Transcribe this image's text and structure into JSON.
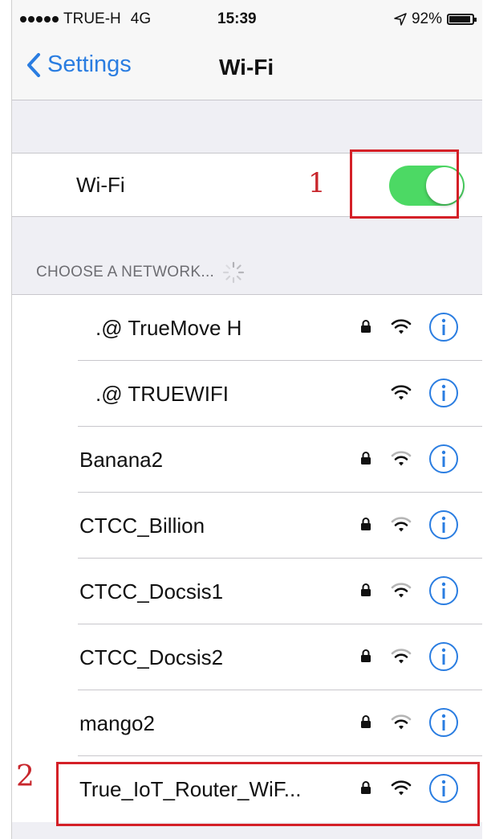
{
  "status_bar": {
    "carrier": "TRUE-H",
    "network_type": "4G",
    "time": "15:39",
    "battery": "92%",
    "battery_level": 0.92
  },
  "nav": {
    "back_label": "Settings",
    "title": "Wi-Fi"
  },
  "wifi_toggle": {
    "label": "Wi-Fi",
    "on": true,
    "on_color": "#4cd964"
  },
  "annotations": {
    "marker_1": "1",
    "marker_2": "2",
    "color": "#d42027"
  },
  "section_header": "CHOOSE A NETWORK...",
  "networks": [
    {
      "name": ".@ TrueMove H",
      "locked": true
    },
    {
      "name": ".@ TRUEWIFI",
      "locked": false
    },
    {
      "name": "Banana2",
      "locked": true
    },
    {
      "name": "CTCC_Billion",
      "locked": true
    },
    {
      "name": "CTCC_Docsis1",
      "locked": true
    },
    {
      "name": "CTCC_Docsis2",
      "locked": true
    },
    {
      "name": "mango2",
      "locked": true
    },
    {
      "name": "True_IoT_Router_WiF...",
      "locked": true
    }
  ],
  "accent_color": "#2a7de1"
}
